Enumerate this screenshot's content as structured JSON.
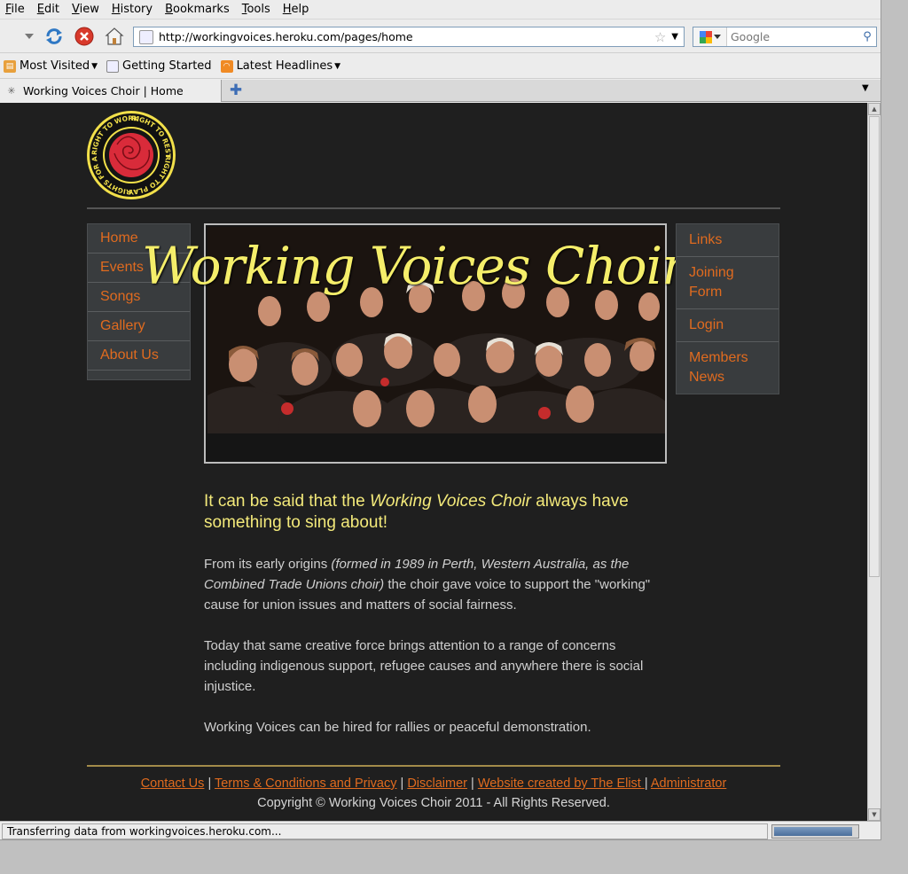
{
  "menu": [
    "File",
    "Edit",
    "View",
    "History",
    "Bookmarks",
    "Tools",
    "Help"
  ],
  "navigation": {
    "url": "http://workingvoices.heroku.com/pages/home",
    "search_placeholder": "Google"
  },
  "bookmarks": {
    "most_visited": "Most Visited",
    "getting_started": "Getting Started",
    "latest_headlines": "Latest Headlines"
  },
  "tab": {
    "title": "Working Voices Choir | Home"
  },
  "status": {
    "text": "Transferring data from workingvoices.heroku.com...",
    "progress": 0.95
  },
  "page": {
    "logo_ring_text": [
      "RIGHT TO WORK",
      "RIGHT TO REST",
      "RIGHT TO PLAY",
      "RIGHTS FOR ALL"
    ],
    "nav_left": [
      "Home",
      "Events",
      "Songs",
      "Gallery",
      "About Us"
    ],
    "nav_right": [
      "Links",
      "Joining Form",
      "Login",
      "Members News"
    ],
    "hero_title": "Working Voices Choir",
    "lead_part1": "It can be said that the ",
    "lead_em": "Working Voices Choir",
    "lead_part2": " always have something to sing about!",
    "para1_part1": "From its early origins ",
    "para1_em": "(formed in 1989 in Perth, Western Australia, as the Combined Trade Unions choir)",
    "para1_part2": " the choir gave voice to support the \"working\" cause for union issues and matters of social fairness.",
    "para2": "Today that same creative force brings attention to a range of concerns including indigenous support, refugee causes and anywhere there is social injustice.",
    "para3": "Working Voices can be hired for rallies or peaceful demonstration.",
    "footer_links": [
      "Contact Us",
      "Terms & Conditions and Privacy",
      "Disclaimer",
      "Website created by The Elist ",
      "Administrator"
    ],
    "copyright": "Copyright © Working Voices Choir 2011 - All Rights Reserved."
  },
  "colors": {
    "page_bg": "#1f1f1f",
    "nav_link": "#e06b1f",
    "hero_title": "#f5ee6a",
    "lead_text": "#f3e97a"
  }
}
